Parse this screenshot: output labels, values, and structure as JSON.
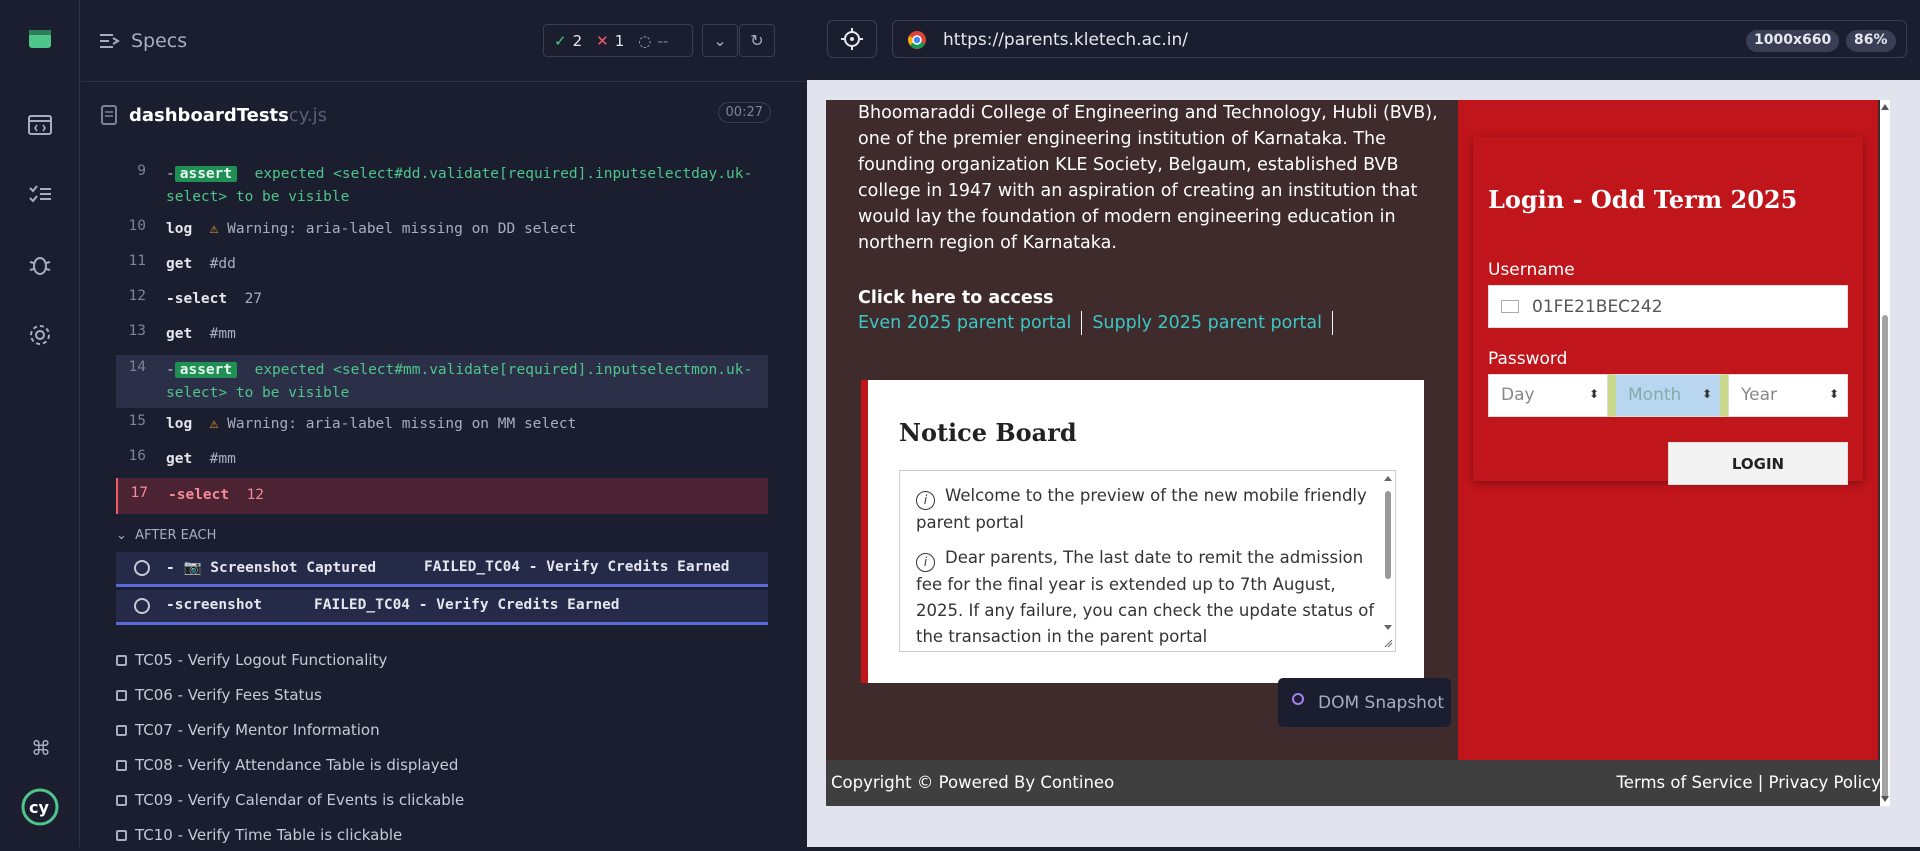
{
  "reporter": {
    "title": "Specs",
    "passed": "2",
    "failed": "1",
    "pending": "--",
    "file_name": "dashboardTests",
    "file_ext": "cy.js",
    "timer": "00:27",
    "commands": [
      {
        "num": "9",
        "name": "assert",
        "text": "expected <select#dd.validate[required].inputselectday.uk-select> to be visible"
      },
      {
        "num": "10",
        "name": "log",
        "text": "Warning: aria-label missing on DD select"
      },
      {
        "num": "11",
        "name": "get",
        "text": "#dd"
      },
      {
        "num": "12",
        "name": "-select",
        "text": "27"
      },
      {
        "num": "13",
        "name": "get",
        "text": "#mm"
      },
      {
        "num": "14",
        "name": "assert",
        "text": "expected <select#mm.validate[required].inputselectmon.uk-select> to be visible"
      },
      {
        "num": "15",
        "name": "log",
        "text": "Warning: aria-label missing on MM select"
      },
      {
        "num": "16",
        "name": "get",
        "text": "#mm"
      },
      {
        "num": "17",
        "name": "-select",
        "text": "12"
      }
    ],
    "after_each": "AFTER EACH",
    "shots": [
      {
        "name": "- 📷 Screenshot Captured",
        "text": "FAILED_TC04 - Verify Credits Earned"
      },
      {
        "name": "-screenshot",
        "text": "FAILED_TC04 - Verify Credits Earned"
      }
    ],
    "tests": [
      "TC05 - Verify Logout Functionality",
      "TC06 - Verify Fees Status",
      "TC07 - Verify Mentor Information",
      "TC08 - Verify Attendance Table is displayed",
      "TC09 - Verify Calendar of Events is clickable",
      "TC10 - Verify Time Table is clickable"
    ]
  },
  "browser": {
    "url": "https://parents.kletech.ac.in/",
    "viewport": "1000x660",
    "zoom": "86%"
  },
  "site": {
    "intro": "Bhoomaraddi College of Engineering and Technology, Hubli (BVB), one of the premier engineering institution of Karnataka. The founding organization KLE Society, Belgaum, established BVB college in 1947 with an aspiration of creating an institution that would lay the foundation of modern engineering education in northern region of Karnataka.",
    "access_label": "Click here to access",
    "links": [
      "Even 2025 parent portal",
      "Supply 2025 parent portal"
    ],
    "notice_title": "Notice Board",
    "notices": [
      "Welcome to the preview of the new mobile friendly parent portal",
      "Dear parents, The last date to remit the admission fee for the final year is extended up to 7th August, 2025. If any failure, you can check the update status of the transaction in the parent portal"
    ],
    "dom_snapshot": "DOM Snapshot",
    "login_title": "Login - Odd Term 2025",
    "username_label": "Username",
    "username_value": "01FE21BEC242",
    "password_label": "Password",
    "day": "Day",
    "month": "Month",
    "year": "Year",
    "login_button": "LOGIN",
    "footer_left": "Copyright © Powered By Contineo",
    "footer_right": "Terms of Service | Privacy Policy"
  }
}
